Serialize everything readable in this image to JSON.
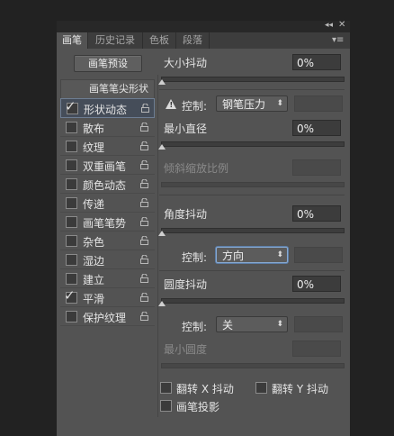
{
  "window": {
    "collapse_glyph": "◂◂",
    "close_glyph": "✕"
  },
  "tabs": [
    "画笔",
    "历史记录",
    "色板",
    "段落"
  ],
  "tab_menu_glyph": "▾≡",
  "preset_button": "画笔预设",
  "tip_shape_header": "画笔笔尖形状",
  "left_items": [
    {
      "label": "形状动态",
      "checked": true,
      "selected": true
    },
    {
      "label": "散布",
      "checked": false
    },
    {
      "label": "纹理",
      "checked": false
    },
    {
      "label": "双重画笔",
      "checked": false
    },
    {
      "label": "颜色动态",
      "checked": false
    },
    {
      "label": "传递",
      "checked": false
    },
    {
      "label": "画笔笔势",
      "checked": false
    },
    {
      "label": "杂色",
      "checked": false
    },
    {
      "label": "湿边",
      "checked": false
    },
    {
      "label": "建立",
      "checked": false
    },
    {
      "label": "平滑",
      "checked": true
    },
    {
      "label": "保护纹理",
      "checked": false
    }
  ],
  "check_glyph": "✓",
  "size_jitter": {
    "label": "大小抖动",
    "value": "0%"
  },
  "control1": {
    "label": "控制:",
    "value": "钢笔压力"
  },
  "min_diameter": {
    "label": "最小直径",
    "value": "0%"
  },
  "tilt_scale": {
    "label": "倾斜缩放比例"
  },
  "angle_jitter": {
    "label": "角度抖动",
    "value": "0%"
  },
  "control2": {
    "label": "控制:",
    "value": "方向"
  },
  "roundness_jitter": {
    "label": "圆度抖动",
    "value": "0%"
  },
  "control3": {
    "label": "控制:",
    "value": "关"
  },
  "min_roundness": {
    "label": "最小圆度"
  },
  "flip_x": {
    "label": "翻转 X 抖动"
  },
  "flip_y": {
    "label": "翻转 Y 抖动"
  },
  "brush_projection": {
    "label": "画笔投影"
  },
  "warning_glyph": "!",
  "select_arrow": "⬍"
}
